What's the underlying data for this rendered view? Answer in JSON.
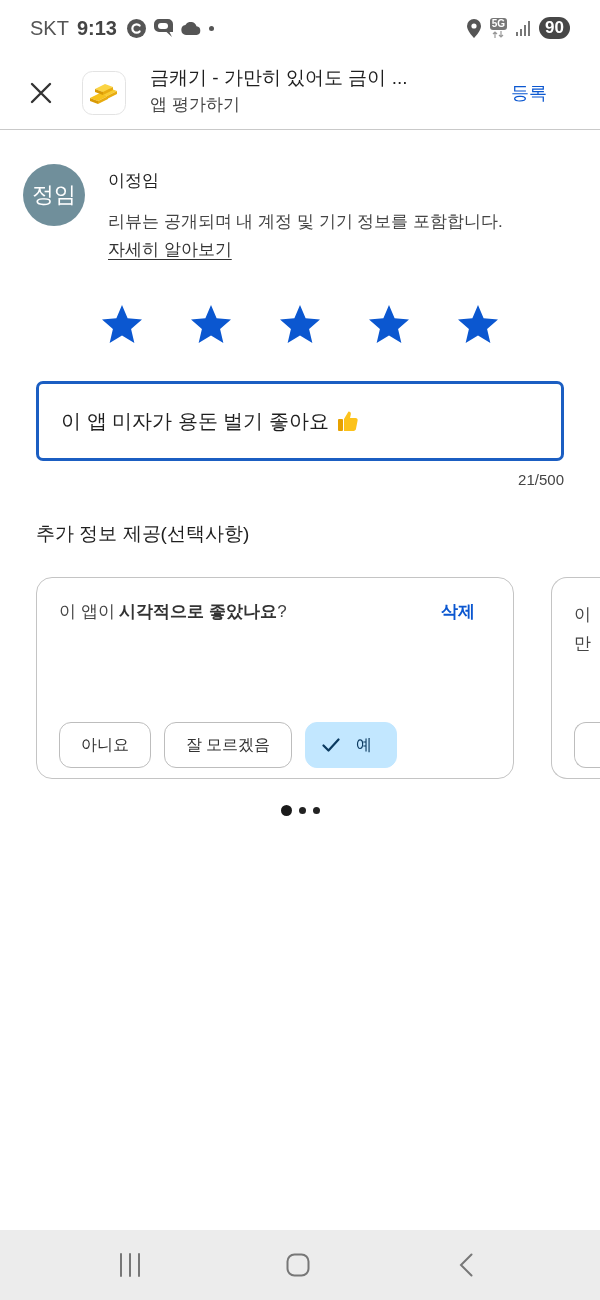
{
  "status_bar": {
    "carrier": "SKT",
    "time": "9:13",
    "network": "5G",
    "battery": "90"
  },
  "header": {
    "title": "금캐기 - 가만히 있어도 금이 ...",
    "subtitle": "앱 평가하기",
    "submit": "등록"
  },
  "reviewer": {
    "initials": "정임",
    "name": "이정임",
    "notice": "리뷰는 공개되며 내 계정 및 기기 정보를 포함합니다.",
    "link": "자세히 알아보기"
  },
  "rating": {
    "stars": 5
  },
  "review": {
    "value": "이 앱 미자가 용돈 벌기 좋아요",
    "counter": "21/500"
  },
  "extra_info": {
    "title": "추가 정보 제공(선택사항)",
    "cards": [
      {
        "kind": "full",
        "question": "이 앱이 **시각적으로 좋았나요**?",
        "clear": "삭제",
        "answers": [
          {
            "label": "아니요",
            "selected": false
          },
          {
            "label": "잘 모르겠음",
            "selected": false
          },
          {
            "label": "예",
            "selected": true
          }
        ]
      },
      {
        "kind": "peek",
        "question_lines": [
          "이",
          "만"
        ],
        "answers": [
          {
            "selected": false
          }
        ]
      }
    ],
    "pages": [
      {
        "selected": true
      },
      {
        "selected": false
      },
      {
        "selected": false
      }
    ]
  }
}
